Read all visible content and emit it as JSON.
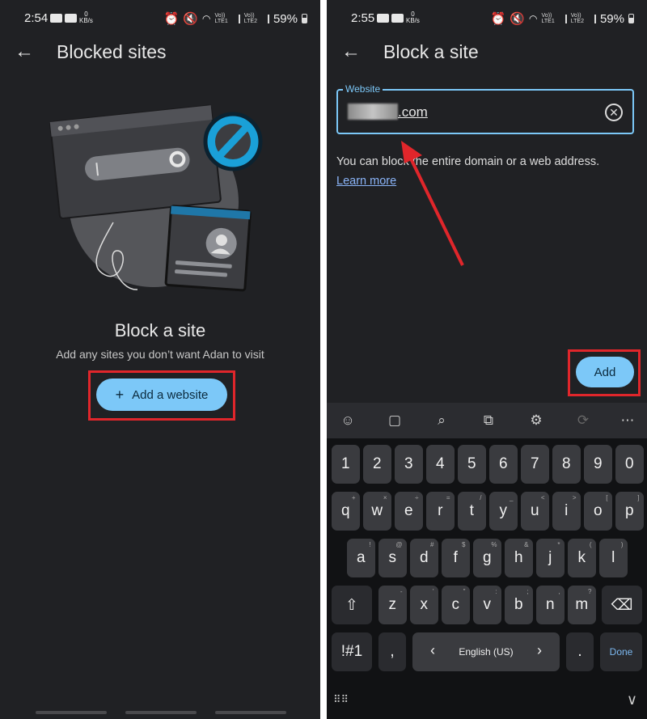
{
  "left": {
    "status": {
      "time": "2:54",
      "kbs_top": "0",
      "kbs_bottom": "KB/s",
      "net1": "Vo))",
      "net1b": "LTE1",
      "net2": "Vo))",
      "net2b": "LTE2",
      "battery": "59%"
    },
    "title": "Blocked sites",
    "heading": "Block a site",
    "subtitle": "Add any sites you don’t want Adan to visit",
    "add_button": "Add a website",
    "add_icon": "+"
  },
  "right": {
    "status": {
      "time": "2:55",
      "kbs_top": "0",
      "kbs_bottom": "KB/s",
      "net1": "Vo))",
      "net1b": "LTE1",
      "net2": "Vo))",
      "net2b": "LTE2",
      "battery": "59%"
    },
    "title": "Block a site",
    "field_label": "Website",
    "field_value": ".com",
    "hint": "You can block the entire domain or a web address.",
    "learn_more": "Learn more",
    "add_button": "Add"
  },
  "keyboard": {
    "toolbar_icons": [
      "emoji-icon",
      "clipboard-icon",
      "search-icon",
      "translate-icon",
      "settings-icon",
      "mode-icon",
      "more-icon"
    ],
    "numbers": [
      "1",
      "2",
      "3",
      "4",
      "5",
      "6",
      "7",
      "8",
      "9",
      "0"
    ],
    "row1": [
      "q",
      "w",
      "e",
      "r",
      "t",
      "y",
      "u",
      "i",
      "o",
      "p"
    ],
    "row1_sup": [
      "+",
      "×",
      "÷",
      "=",
      "/",
      "_",
      "<",
      ">",
      "[",
      "]"
    ],
    "row2": [
      "a",
      "s",
      "d",
      "f",
      "g",
      "h",
      "j",
      "k",
      "l"
    ],
    "row2_sup": [
      "!",
      "@",
      "#",
      "$",
      "%",
      "&",
      "*",
      "(",
      ")"
    ],
    "row3": [
      "z",
      "x",
      "c",
      "v",
      "b",
      "n",
      "m"
    ],
    "row3_sup": [
      "-",
      "'",
      "\"",
      ":",
      ";",
      ",",
      "?"
    ],
    "symbols_key": "!#1",
    "comma_key": ",",
    "space_label": "English (US)",
    "period_key": ".",
    "done_key": "Done"
  },
  "colors": {
    "accent": "#7cc8f8",
    "highlight": "#e0262b",
    "background": "#202124"
  }
}
